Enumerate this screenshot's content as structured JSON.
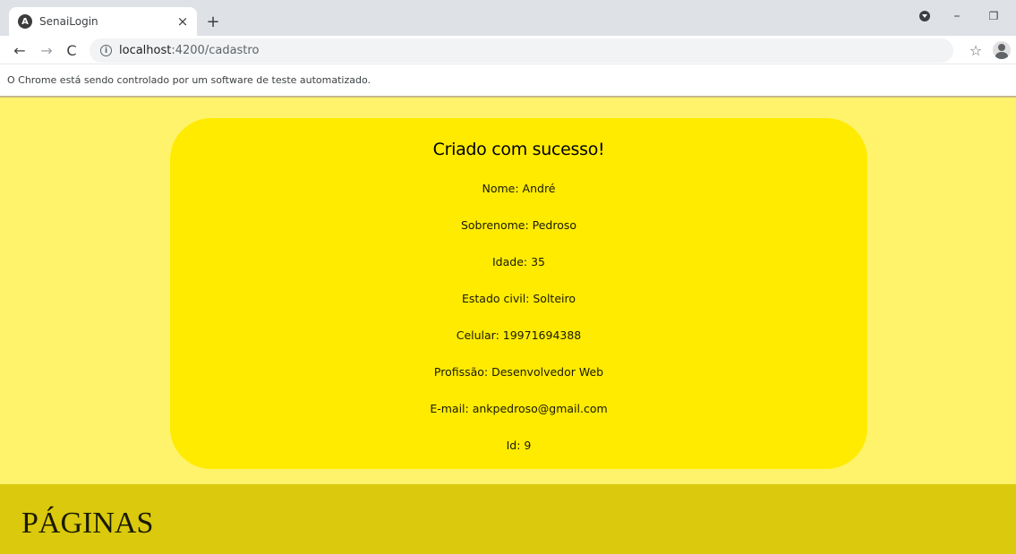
{
  "browser": {
    "tab": {
      "favicon_letter": "A",
      "title": "SenaiLogin",
      "close": "×"
    },
    "new_tab": "+",
    "window_controls": {
      "minimize": "–",
      "restore": "❐"
    },
    "nav": {
      "back": "←",
      "forward": "→",
      "reload": "C"
    },
    "address": {
      "info_icon": "i",
      "host": "localhost",
      "path": ":4200/cadastro"
    },
    "bookmark": "☆",
    "infobar_text": "O Chrome está sendo controlado por um software de teste automatizado."
  },
  "card": {
    "title": "Criado com sucesso!",
    "fields": [
      "Nome: André",
      "Sobrenome: Pedroso",
      "Idade: 35",
      "Estado civil: Solteiro",
      "Celular: 19971694388",
      "Profissão: Desenvolvedor Web",
      "E-mail: ankpedroso@gmail.com",
      "Id: 9"
    ]
  },
  "footer": {
    "title": "PÁGINAS"
  },
  "colors": {
    "page_bg": "#fff36b",
    "card_bg": "#ffeb00",
    "footer_bg": "#dac90d"
  }
}
